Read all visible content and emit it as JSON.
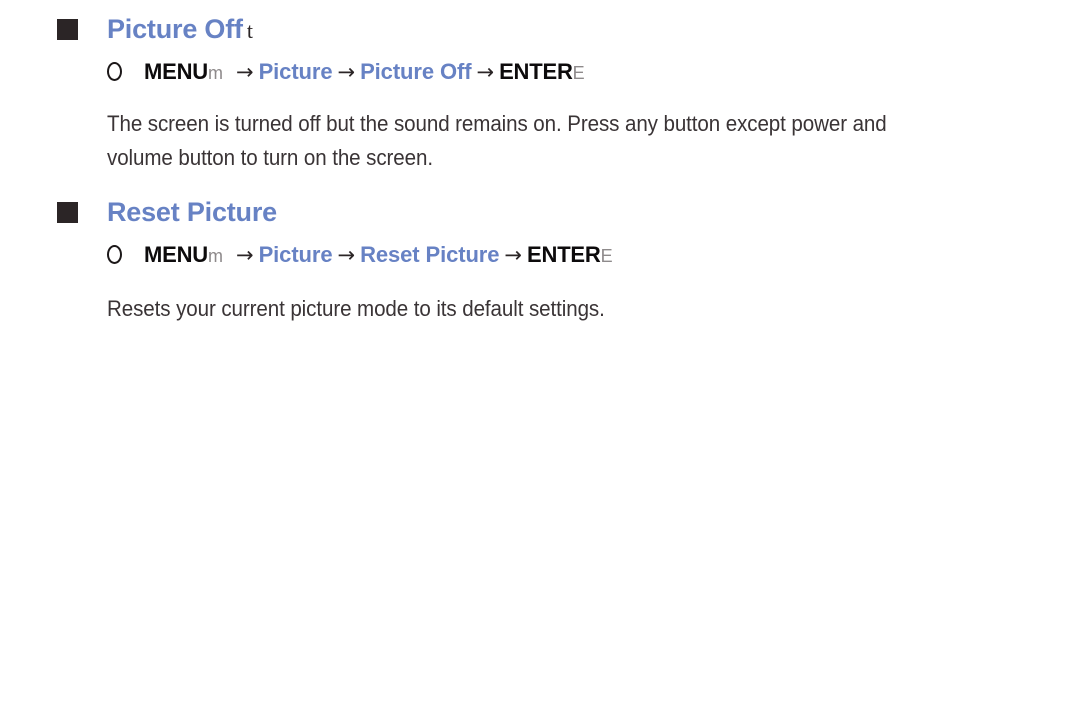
{
  "page": {
    "background_color": "#ffffff",
    "accent_color": "#6782c4",
    "text_color": "#3a3436",
    "bullet_color": "#2b2526",
    "accessory_glyph_color": "#8e8a8b"
  },
  "sections": [
    {
      "bullet_icon": "filled-square-bullet",
      "heading": "Picture Off",
      "heading_key_glyph": "t",
      "path": {
        "circle_icon": "hollow-circle-bullet",
        "menu_label": "MENU",
        "menu_key_glyph": "m",
        "arrow": "→",
        "step_1": "Picture",
        "step_2": "Picture Off",
        "enter_label": "ENTER",
        "enter_key_glyph": "E"
      },
      "body": "The screen is turned off but the sound remains on. Press any button except power and volume button to turn on the screen."
    },
    {
      "bullet_icon": "filled-square-bullet",
      "heading": "Reset Picture",
      "heading_key_glyph": "",
      "path": {
        "circle_icon": "hollow-circle-bullet",
        "menu_label": "MENU",
        "menu_key_glyph": "m",
        "arrow": "→",
        "step_1": "Picture",
        "step_2": "Reset Picture",
        "enter_label": "ENTER",
        "enter_key_glyph": "E"
      },
      "body": "Resets your current picture mode to its default settings."
    }
  ]
}
